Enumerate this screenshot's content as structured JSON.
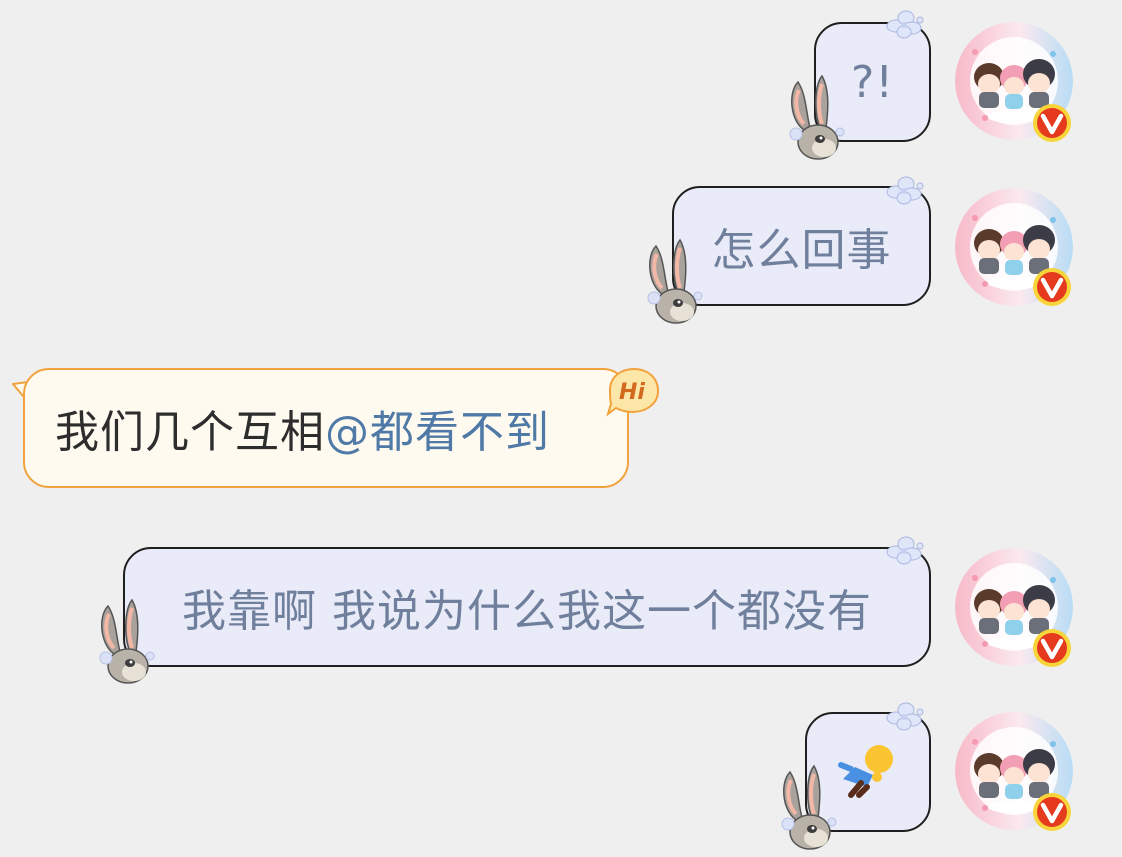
{
  "messages": [
    {
      "direction": "out",
      "text": "?!"
    },
    {
      "direction": "out",
      "text": "怎么回事"
    },
    {
      "direction": "in",
      "text": "我们几个互相",
      "mention": "@都看不到",
      "badge": "Hi"
    },
    {
      "direction": "out",
      "text": "我靠啊 我说为什么我这一个都没有"
    },
    {
      "direction": "out",
      "emoji": "person-lying-down"
    }
  ],
  "avatar_badge": "V",
  "colors": {
    "background": "#efefef",
    "out_bubble_fill": "#e9ecf8",
    "out_bubble_text": "#6f7f9c",
    "in_bubble_fill": "#fffaef",
    "in_bubble_border": "#f2a23c",
    "mention": "#4f79a6",
    "badge_red": "#e53a1e",
    "badge_ring": "#f7d53a"
  }
}
